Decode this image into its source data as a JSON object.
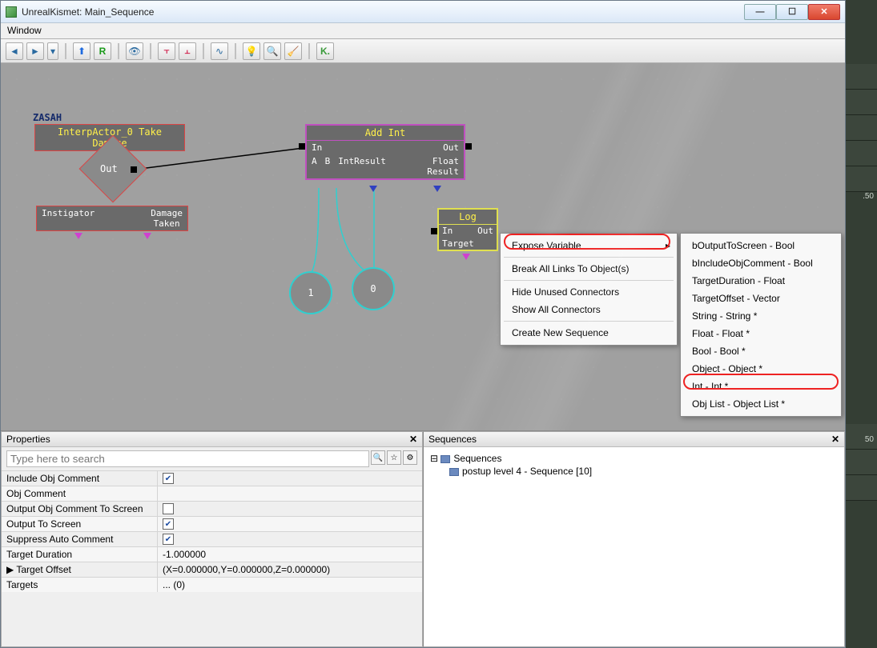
{
  "window": {
    "title": "UnrealKismet: Main_Sequence"
  },
  "menubar": {
    "window": "Window"
  },
  "canvas": {
    "comment": "ZASAH",
    "event_node": "InterpActor_0 Take Damage",
    "event_out": "Out",
    "event_vars": {
      "instigator": "Instigator",
      "damage": "Damage\nTaken"
    },
    "addint": {
      "title": "Add Int",
      "in": "In",
      "out": "Out",
      "a": "A",
      "b": "B",
      "intres": "IntResult",
      "floatres": "Float\nResult"
    },
    "const1": "1",
    "const0": "0",
    "log": {
      "title": "Log",
      "in": "In",
      "out": "Out",
      "target": "Target"
    }
  },
  "context1": {
    "expose": "Expose Variable",
    "breaklinks": "Break All Links To Object(s)",
    "hideconn": "Hide Unused Connectors",
    "showconn": "Show All Connectors",
    "newseq": "Create New Sequence"
  },
  "context2": {
    "items": [
      "bOutputToScreen - Bool",
      "bIncludeObjComment - Bool",
      "TargetDuration - Float",
      "TargetOffset - Vector",
      "String - String *",
      "Float - Float *",
      "Bool - Bool *",
      "Object - Object *",
      "Int - Int *",
      "Obj List - Object List *"
    ]
  },
  "properties": {
    "title": "Properties",
    "placeholder": "Type here to search",
    "rows": [
      {
        "name": "Include Obj Comment",
        "type": "check",
        "val": true
      },
      {
        "name": "Obj Comment",
        "type": "text",
        "val": ""
      },
      {
        "name": "Output Obj Comment To Screen",
        "type": "check",
        "val": false
      },
      {
        "name": "Output To Screen",
        "type": "check",
        "val": true
      },
      {
        "name": "Suppress Auto Comment",
        "type": "check",
        "val": true
      },
      {
        "name": "Target Duration",
        "type": "text",
        "val": "-1.000000"
      },
      {
        "name": "▶ Target Offset",
        "type": "text",
        "val": "(X=0.000000,Y=0.000000,Z=0.000000)"
      },
      {
        "name": "Targets",
        "type": "text",
        "val": "... (0)"
      }
    ]
  },
  "sequences": {
    "title": "Sequences",
    "root": "Sequences",
    "child": "postup level 4 - Sequence [10]"
  },
  "rightstrip": {
    "v1": ".50",
    "v2": "50"
  }
}
